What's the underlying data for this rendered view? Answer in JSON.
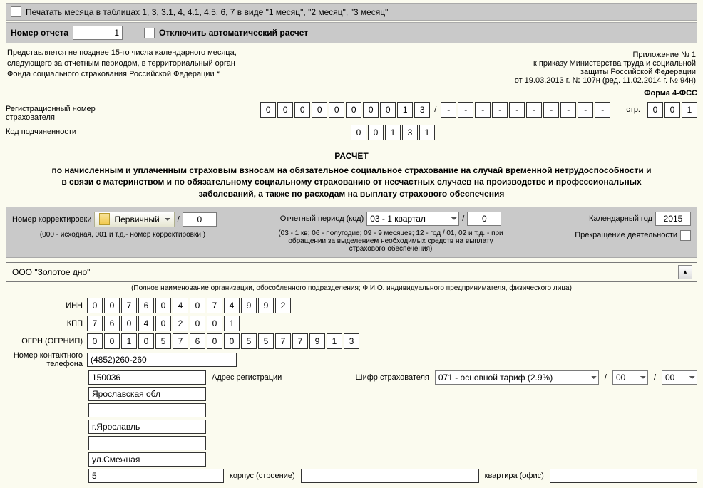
{
  "topbar1": {
    "print_months": "Печатать месяца в таблицах 1, 3, 3.1, 4, 4.1, 4.5, 6, 7 в виде \"1 месяц\", \"2 месяц\", \"3 месяц\""
  },
  "topbar2": {
    "report_num_lbl": "Номер отчета",
    "report_num": "1",
    "disable_autocalc": "Отключить автоматический расчет"
  },
  "appendix": {
    "l1": "Приложение № 1",
    "l2": "к приказу Министерства труда и социальной",
    "l3": "защиты Российской Федерации",
    "l4": "от 19.03.2013 г. № 107н (ред. 11.02.2014 г. № 94н)"
  },
  "note": {
    "l1": "Представляется не позднее 15-го числа календарного месяца,",
    "l2": "следующего за отчетным периодом, в территориальный орган",
    "l3": "Фонда социального страхования Российской Федерации *"
  },
  "form_name": "Форма 4-ФСС",
  "reg": {
    "lbl": "Регистрационный номер страхователя",
    "d": [
      "0",
      "0",
      "0",
      "0",
      "0",
      "0",
      "0",
      "0",
      "1",
      "3"
    ],
    "d2": [
      "-",
      "-",
      "-",
      "-",
      "-",
      "-",
      "-",
      "-",
      "-",
      "-"
    ],
    "page_lbl": "стр.",
    "page": [
      "0",
      "0",
      "1"
    ]
  },
  "sub": {
    "lbl": "Код подчиненности",
    "d": [
      "0",
      "0",
      "1",
      "3",
      "1"
    ]
  },
  "title": "РАСЧЕТ",
  "subtitle": "по начисленным и уплаченным страховым взносам на обязательное социальное страхование на случай временной нетрудоспособности и в связи с материнством и по обязательному социальному страхованию от несчастных случаев на производстве и профессиональных заболеваний, а также по расходам на выплату страхового обеспечения",
  "corr": {
    "lbl": "Номер корректировки",
    "sel": "Первичный",
    "num": "0",
    "hint": "(000 - исходная, 001 и т.д.- номер корректировки )"
  },
  "period": {
    "lbl": "Отчетный период (код)",
    "sel": "03 - 1 квартал",
    "num": "0",
    "hint": "(03 - 1 кв; 06 - полугодие; 09 - 9 месяцев; 12 - год / 01, 02 и т.д. - при обращении за выделением необходимых средств на выплату страхового обеспечения)"
  },
  "year": {
    "lbl": "Календарный год",
    "val": "2015"
  },
  "cease": {
    "lbl": "Прекращение деятельности"
  },
  "org": {
    "name": "ООО \"Золотое дно\"",
    "caption": "(Полное наименование организации, обособленного подразделения; Ф.И.О. индивидуального предпринимателя, физического лица)"
  },
  "inn": {
    "lbl": "ИНН",
    "d": [
      "0",
      "0",
      "7",
      "6",
      "0",
      "4",
      "0",
      "7",
      "4",
      "9",
      "9",
      "2"
    ]
  },
  "kpp": {
    "lbl": "КПП",
    "d": [
      "7",
      "6",
      "0",
      "4",
      "0",
      "2",
      "0",
      "0",
      "1"
    ]
  },
  "ogrn": {
    "lbl": "ОГРН (ОГРНИП)",
    "d": [
      "0",
      "0",
      "1",
      "0",
      "5",
      "7",
      "6",
      "0",
      "0",
      "5",
      "5",
      "7",
      "7",
      "9",
      "1",
      "3"
    ]
  },
  "phone": {
    "lbl": "Номер контактного телефона",
    "val": "(4852)260-260"
  },
  "addr": {
    "zip": "150036",
    "reg_lbl": "Адрес регистрации",
    "ins_code_lbl": "Шифр страхователя",
    "ins_code": "071 - основной тариф (2.9%)",
    "c1": "00",
    "c2": "00",
    "region": "Ярославская обл",
    "city": "г.Ярославль",
    "street": "ул.Смежная",
    "house": "5",
    "korpus_lbl": "корпус (строение)",
    "korpus": "",
    "flat_lbl": "квартира (офис)",
    "flat": ""
  }
}
